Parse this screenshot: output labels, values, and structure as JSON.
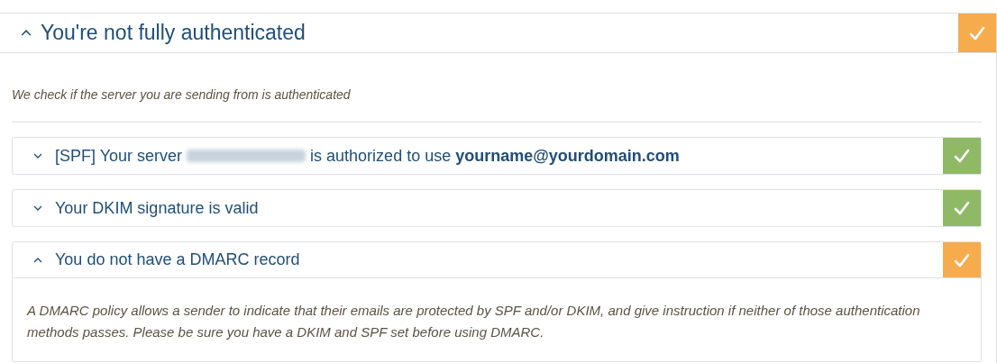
{
  "panel": {
    "title": "You're not fully authenticated",
    "expanded": true,
    "color": "#f6ab4d",
    "description": "We check if the server you are sending from is authenticated",
    "checks": [
      {
        "title": "[SPF] Your server",
        "redacted": true,
        "title_after": "is authorized to use **yourname@yourdomain.com**",
        "expanded": false,
        "color": "#8fb965"
      },
      {
        "title": "Your DKIM signature is valid",
        "expanded": false,
        "color": "#8fb965"
      },
      {
        "title": "You do not have a DMARC record",
        "expanded": true,
        "color": "#f6ab4d",
        "description": "A DMARC policy allows a sender to indicate that their emails are protected by SPF and/or DKIM, and give instruction if neither of those authentication methods passes. Please be sure you have a DKIM and SPF set before using DMARC."
      }
    ]
  }
}
